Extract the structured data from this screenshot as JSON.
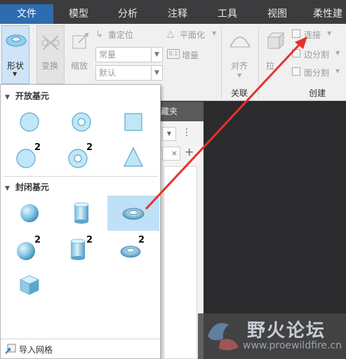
{
  "tabs": [
    {
      "label": "文件",
      "active": true
    },
    {
      "label": "模型",
      "active": false
    },
    {
      "label": "分析",
      "active": false
    },
    {
      "label": "注释",
      "active": false
    },
    {
      "label": "工具",
      "active": false
    },
    {
      "label": "视图",
      "active": false
    },
    {
      "label": "柔性建",
      "active": false
    }
  ],
  "ribbon": {
    "shape_label": "形状",
    "transform_label": "变换",
    "scale_label": "缩放",
    "reposition_label": "重定位",
    "planarize_label": "平面化",
    "constant_value": "常量",
    "default_value": "默认",
    "increment_label": "增量",
    "increment_badge": "0.1",
    "align_label": "对齐",
    "extrude_label": "拉",
    "connect_label": "连接",
    "edge_split_label": "边分割",
    "face_split_label": "面分割",
    "group_assoc": "关联",
    "group_create": "创建"
  },
  "background_panel": {
    "head_text": "藏夹"
  },
  "dropdown": {
    "open_section": "开放基元",
    "closed_section": "封闭基元",
    "import_mesh": "导入网格",
    "badge": "2"
  },
  "watermark": {
    "title": "野火论坛",
    "url": "www.proewildfire.cn"
  },
  "colors": {
    "accent_tab": "#2d6cb0",
    "selection": "#bfe1f7",
    "arrow": "#e8302a",
    "primitive_fill": "#bfe7f7"
  }
}
